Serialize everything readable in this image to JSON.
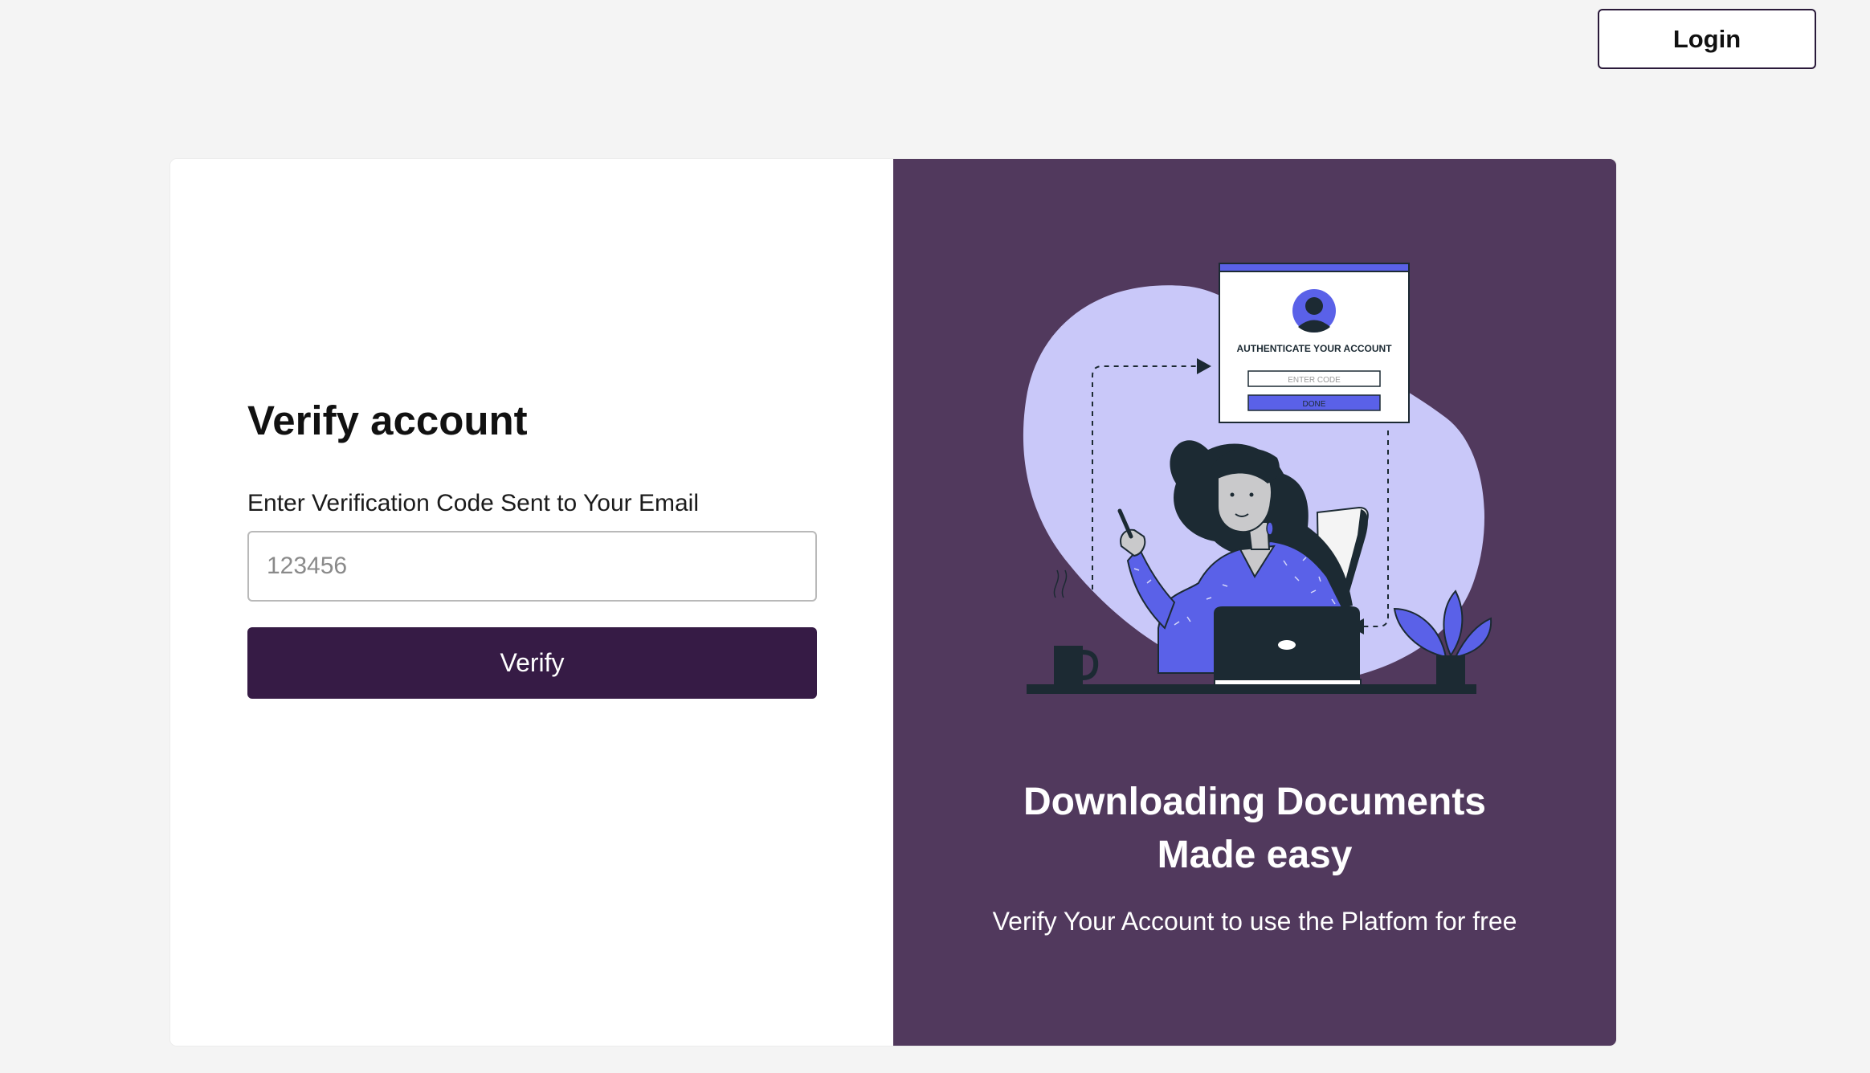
{
  "header": {
    "login_label": "Login"
  },
  "form": {
    "title": "Verify account",
    "code_label": "Enter Verification Code Sent to Your Email",
    "code_placeholder": "123456",
    "code_value": "",
    "verify_label": "Verify"
  },
  "promo": {
    "title_line_1": "Downloading Documents",
    "title_line_2": "Made easy",
    "subtitle": "Verify Your Account to use the Platfom for free",
    "illustration": {
      "card_heading": "AUTHENTICATE YOUR ACCOUNT",
      "card_input_placeholder": "ENTER CODE",
      "card_button_label": "DONE"
    }
  },
  "colors": {
    "page_background": "#f4f4f4",
    "panel_purple": "#51395d",
    "button_dark_purple": "#361b45",
    "illustration_lavender": "#c9c8f9",
    "illustration_blue": "#5a61e8",
    "illustration_dark": "#1c2a33"
  },
  "icons": [
    "user-avatar-icon",
    "arrow-right-icon",
    "arrow-left-icon",
    "pen-icon",
    "laptop-icon",
    "coffee-mug-icon",
    "plant-icon"
  ]
}
